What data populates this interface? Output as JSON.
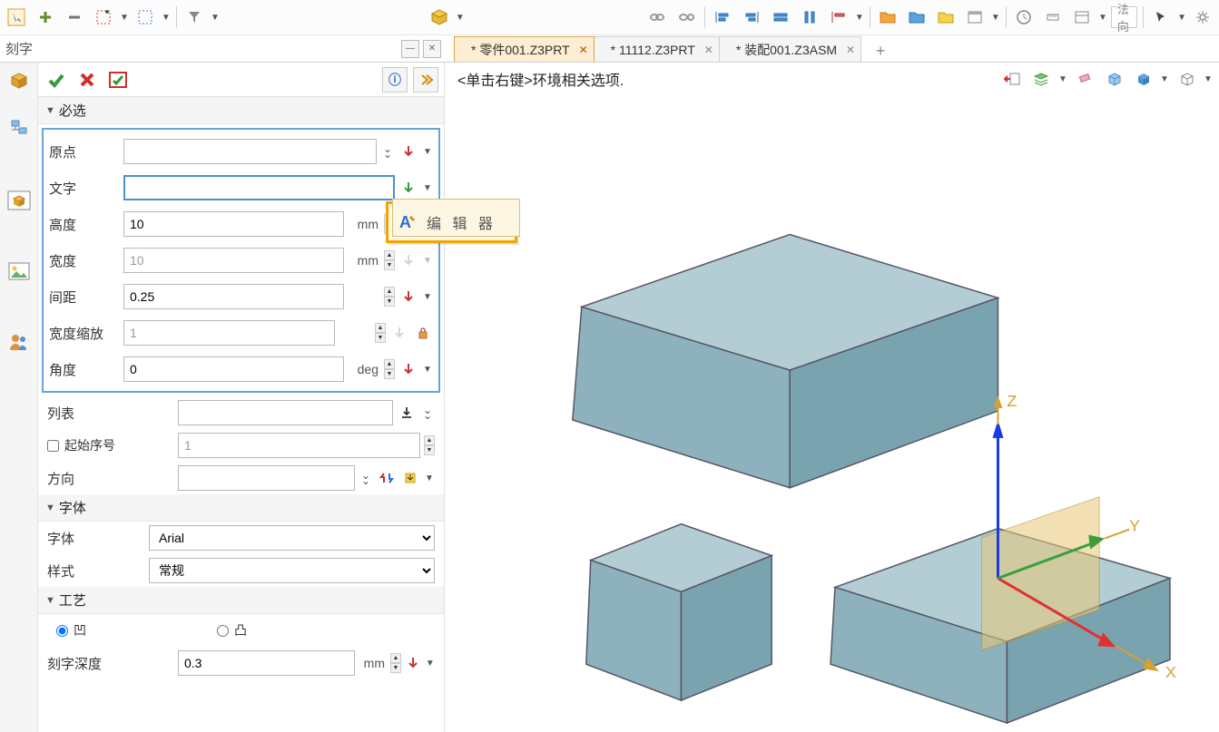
{
  "toolbar": {
    "normal_direction": "法向"
  },
  "panel_title": "刻字",
  "tabs": [
    {
      "label": "* 零件001.Z3PRT",
      "active": true
    },
    {
      "label": "* 11112.Z3PRT",
      "active": false
    },
    {
      "label": "* 装配001.Z3ASM",
      "active": false
    }
  ],
  "hint": "<单击右键>环境相关选项.",
  "sections": {
    "required": {
      "title": "必选",
      "origin_label": "原点",
      "text_label": "文字",
      "height_label": "高度",
      "height_value": "10",
      "height_unit": "mm",
      "width_label": "宽度",
      "width_value": "10",
      "width_unit": "mm",
      "spacing_label": "间距",
      "spacing_value": "0.25",
      "scale_label": "宽度缩放",
      "scale_value": "1",
      "angle_label": "角度",
      "angle_value": "0",
      "angle_unit": "deg"
    },
    "list_group": {
      "list_label": "列表",
      "startnum_label": "起始序号",
      "startnum_value": "1",
      "direction_label": "方向"
    },
    "font": {
      "title": "字体",
      "font_label": "字体",
      "font_value": "Arial",
      "style_label": "样式",
      "style_value": "常规"
    },
    "process": {
      "title": "工艺",
      "concave": "凹",
      "convex": "凸",
      "depth_label": "刻字深度",
      "depth_value": "0.3",
      "depth_unit": "mm"
    }
  },
  "tooltip": "编 辑 器",
  "axes": {
    "x": "X",
    "y": "Y",
    "z": "Z"
  }
}
